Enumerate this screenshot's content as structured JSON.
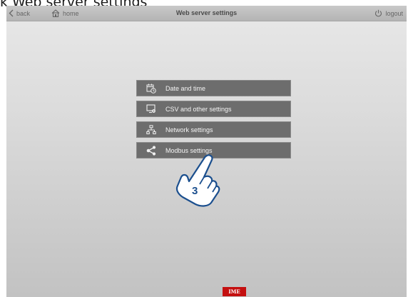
{
  "caption": "k  Web server settings",
  "header": {
    "title": "Web server settings",
    "back_label": "back",
    "home_label": "home",
    "logout_label": "logout"
  },
  "menu": {
    "items": [
      {
        "label": "Date and time",
        "icon": "calendar-clock-icon"
      },
      {
        "label": "CSV and other settings",
        "icon": "monitor-settings-icon"
      },
      {
        "label": "Network settings",
        "icon": "network-icon"
      },
      {
        "label": "Modbus settings",
        "icon": "share-icon"
      }
    ]
  },
  "callout": {
    "step": "3"
  },
  "footer": {
    "logo_text": "IME"
  },
  "colors": {
    "menu_bg": "#6d6d6d",
    "topbar": "#bdbdbd",
    "logo_red": "#c40f0f"
  }
}
